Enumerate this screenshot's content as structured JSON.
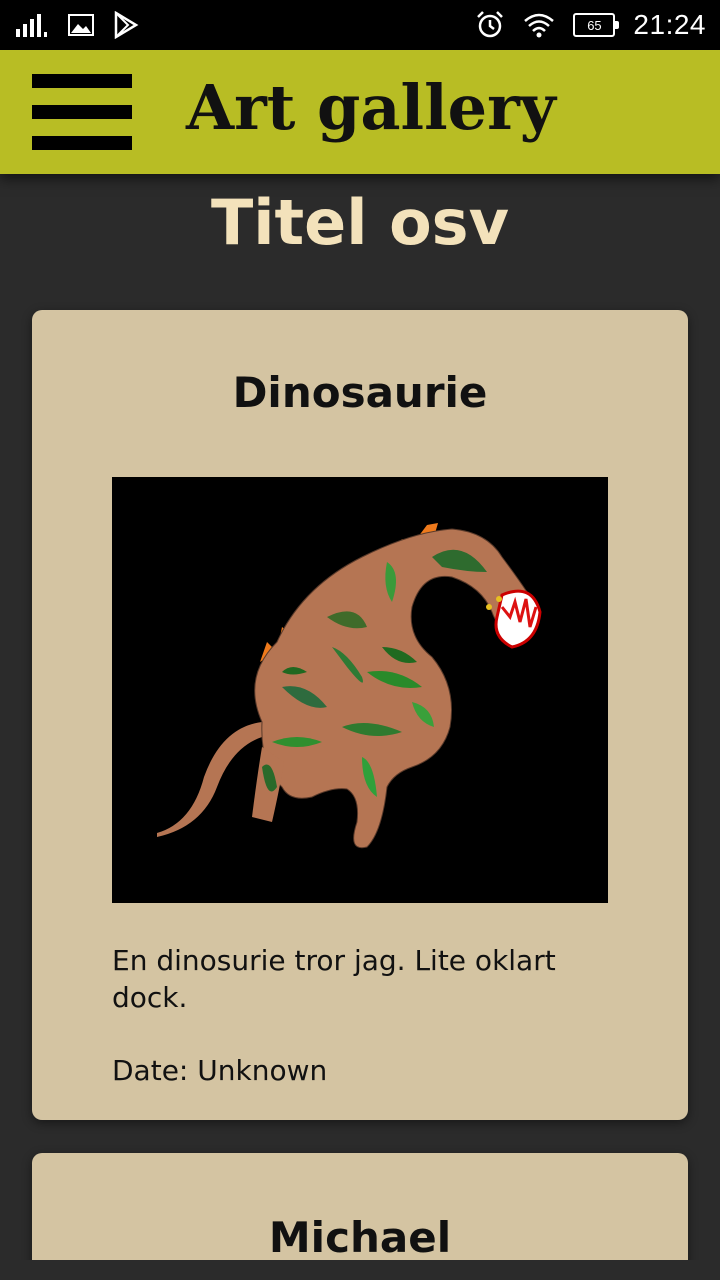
{
  "status_bar": {
    "time": "21:24",
    "battery": "65",
    "icons": [
      "signal-icon",
      "image-icon",
      "play-store-icon",
      "alarm-icon",
      "wifi-icon",
      "battery-icon"
    ]
  },
  "app_bar": {
    "title": "Art gallery",
    "menu_icon": "hamburger-menu-icon",
    "background_color": "#b8bd24"
  },
  "page": {
    "title": "Titel osv",
    "title_color": "#f3e2bb",
    "background_color": "#2b2b2b"
  },
  "artworks": [
    {
      "title": "Dinosaurie",
      "description": "En dinosurie tror jag. Lite oklart dock.",
      "date": "Date: Unknown"
    },
    {
      "title": "Michael"
    }
  ],
  "card_color": "#d4c4a2"
}
